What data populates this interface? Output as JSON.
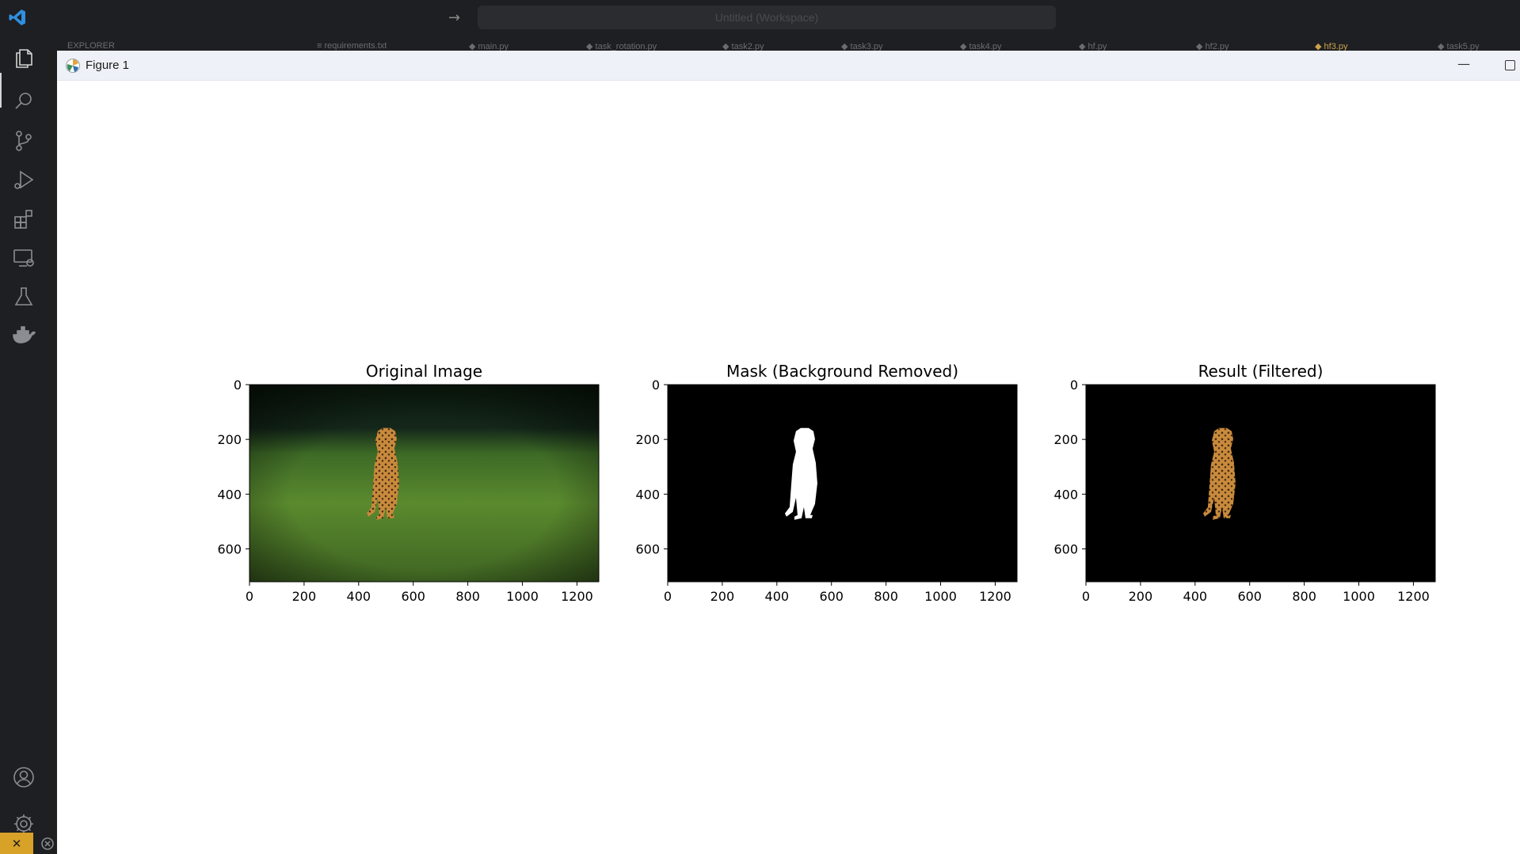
{
  "vscode": {
    "nav_arrow": "→",
    "command_center_text": "Untitled (Workspace)",
    "tabs": [
      "EXPLORER",
      "≡ requirements.txt",
      "◆ main.py",
      "◆ task_rotation.py",
      "◆ task2.py",
      "◆ task3.py",
      "◆ task4.py",
      "◆ hf.py",
      "◆ hf2.py",
      "◆ hf3.py",
      "◆ task5.py"
    ],
    "activity_icons": [
      "files-icon",
      "search-icon",
      "source-control-icon",
      "run-debug-icon",
      "extensions-icon",
      "remote-explorer-icon",
      "testing-icon",
      "docker-icon",
      "account-icon",
      "settings-gear-icon"
    ],
    "remote_button_glyph": "✕",
    "colors": {
      "background": "#1f1f1f",
      "remote_accent": "#d8a127",
      "activity_icon": "#8b8d93"
    }
  },
  "figure": {
    "window_title": "Figure 1",
    "minimize_glyph": "—"
  },
  "chart_data": [
    {
      "type": "image",
      "title": "Original Image",
      "content": "photo of a running cheetah on green grass",
      "xlim": [
        0,
        1280
      ],
      "ylim": [
        720,
        0
      ],
      "xticks": [
        0,
        200,
        400,
        600,
        800,
        1000,
        1200
      ],
      "yticks": [
        0,
        200,
        400,
        600
      ]
    },
    {
      "type": "image",
      "title": "Mask (Background Removed)",
      "content": "binary mask: white cheetah silhouette on black",
      "xlim": [
        0,
        1280
      ],
      "ylim": [
        720,
        0
      ],
      "xticks": [
        0,
        200,
        400,
        600,
        800,
        1000,
        1200
      ],
      "yticks": [
        0,
        200,
        400,
        600
      ]
    },
    {
      "type": "image",
      "title": "Result (Filtered)",
      "content": "cheetah cut out on black background",
      "xlim": [
        0,
        1280
      ],
      "ylim": [
        720,
        0
      ],
      "xticks": [
        0,
        200,
        400,
        600,
        800,
        1000,
        1200
      ],
      "yticks": [
        0,
        200,
        400,
        600
      ]
    }
  ]
}
